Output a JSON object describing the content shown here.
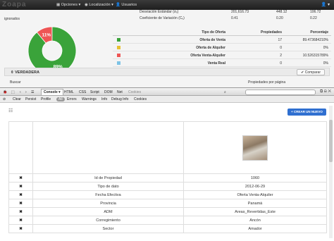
{
  "navbar": {
    "brand": "Zoapa",
    "opciones": "Opciones",
    "localizacion": "Localización",
    "usuarios": "Usuarios",
    "user": "▾"
  },
  "stats": {
    "rows": [
      {
        "label": "Desviación Estándar (σₓ)",
        "v1": "201,616.73",
        "v2": "448.12",
        "v3": "106.72"
      },
      {
        "label": "Coeficiente de Variación (Cᵥ)",
        "v1": "0.41",
        "v2": "0.20",
        "v3": "0.22"
      }
    ]
  },
  "ignorados": "ignorados",
  "chart_data": {
    "type": "pie",
    "categories": [
      "Oferta de Venta",
      "Oferta Venta-Alquiler",
      "Oferta de Alquiler",
      "Venta Real"
    ],
    "values": [
      89,
      11,
      0,
      0
    ],
    "labels": [
      "89%",
      "11%"
    ],
    "colors": [
      "#3aa33a",
      "#ee5555",
      "#e8c233",
      "#7ec3e6"
    ]
  },
  "offer_table": {
    "headers": {
      "tipo": "Tipo de Oferta",
      "prop": "Propiedades",
      "pct": "Porcentaje"
    },
    "rows": [
      {
        "color": "#3aa33a",
        "tipo": "Oferta de Venta",
        "prop": "17",
        "pct": "89.473684210%"
      },
      {
        "color": "#e8c233",
        "tipo": "Oferta de Alquiler",
        "prop": "0",
        "pct": "0%"
      },
      {
        "color": "#ee5555",
        "tipo": "Oferta Venta-Alquiler",
        "prop": "2",
        "pct": "10.526315789%"
      },
      {
        "color": "#7ec3e6",
        "tipo": "Venta Real",
        "prop": "0",
        "pct": "0%"
      }
    ]
  },
  "panel": {
    "title": "VERDADERA",
    "compare": "Comparar",
    "buscar": "Buscar",
    "props_pag": "Propiedades por página"
  },
  "firebug": {
    "tabs": [
      "Console ▾",
      "HTML",
      "CSS",
      "Script",
      "DOM",
      "Net",
      "Cookies"
    ],
    "subtabs": [
      "Clear",
      "Persist",
      "Profile",
      "All",
      "Errors",
      "Warnings",
      "Info",
      "Debug Info",
      "Cookies"
    ]
  },
  "lower": {
    "new_button": "+ CREAR UN NUEVO",
    "rows": [
      {
        "k": "Id de Propiedad",
        "v": "1060"
      },
      {
        "k": "Tipo de dato",
        "v": "2012-06-29"
      },
      {
        "k": "Fecha Efectiva",
        "v": "Oferta Venta-Alquiler"
      },
      {
        "k": "Provincia",
        "v": "Panamá"
      },
      {
        "k": "ADM",
        "v": "Areas_Revertidas_Este"
      },
      {
        "k": "Corregimiento",
        "v": "Ancón"
      },
      {
        "k": "Sector",
        "v": "Amador"
      }
    ],
    "delete_glyph": "✖"
  }
}
